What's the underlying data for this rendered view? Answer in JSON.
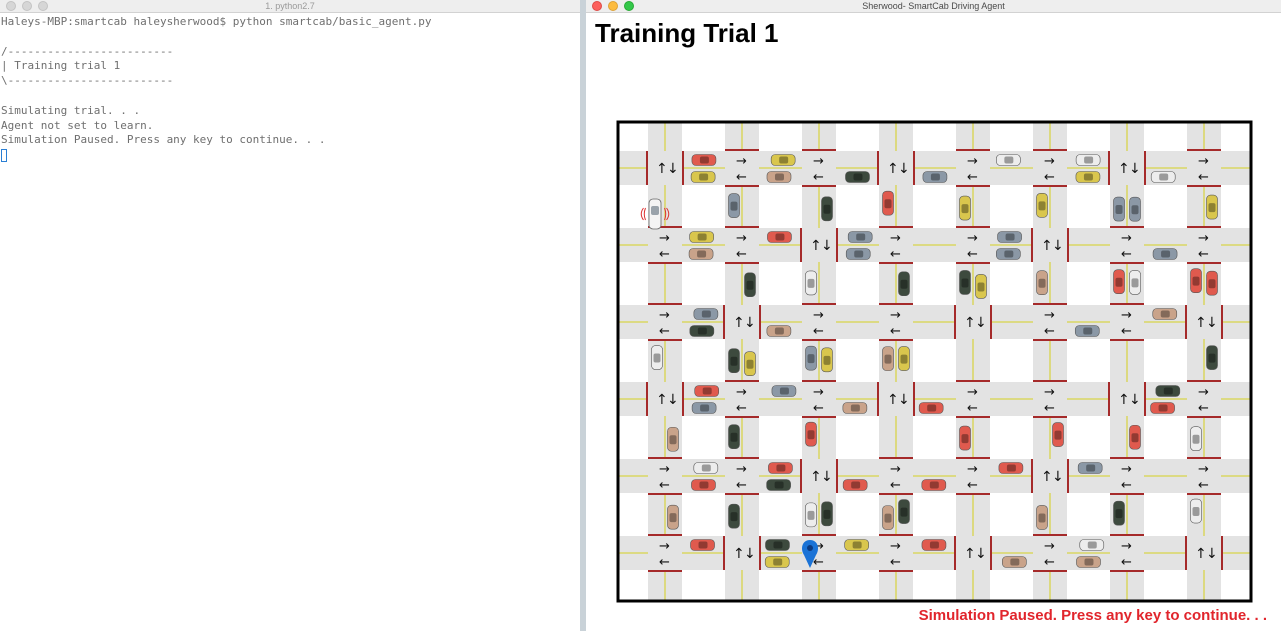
{
  "terminal": {
    "title": "1. python2.7",
    "lines": [
      "Haleys-MBP:smartcab haleysherwood$ python smartcab/basic_agent.py",
      "",
      "/-------------------------",
      "| Training trial 1",
      "\\-------------------------",
      "",
      "Simulating trial. . .",
      "Agent not set to learn.",
      "Simulation Paused. Press any key to continue. . ."
    ]
  },
  "simulator": {
    "window_title": "Sherwood- SmartCab Driving Agent",
    "heading": "Training Trial 1",
    "status": "Simulation Paused. Press any key to continue. . .",
    "road_color": "#e3e3e3",
    "center_line_color": "#d8d44a",
    "stop_line_color": "#a52a2a",
    "destination_marker": "map-pin-icon",
    "agent_icon": "white-cab-with-signal-icon",
    "car_colors": [
      "#e05a4e",
      "#3d4a3e",
      "#8b98a6",
      "#d9c64d",
      "#c9a38a",
      "#ededed"
    ]
  }
}
